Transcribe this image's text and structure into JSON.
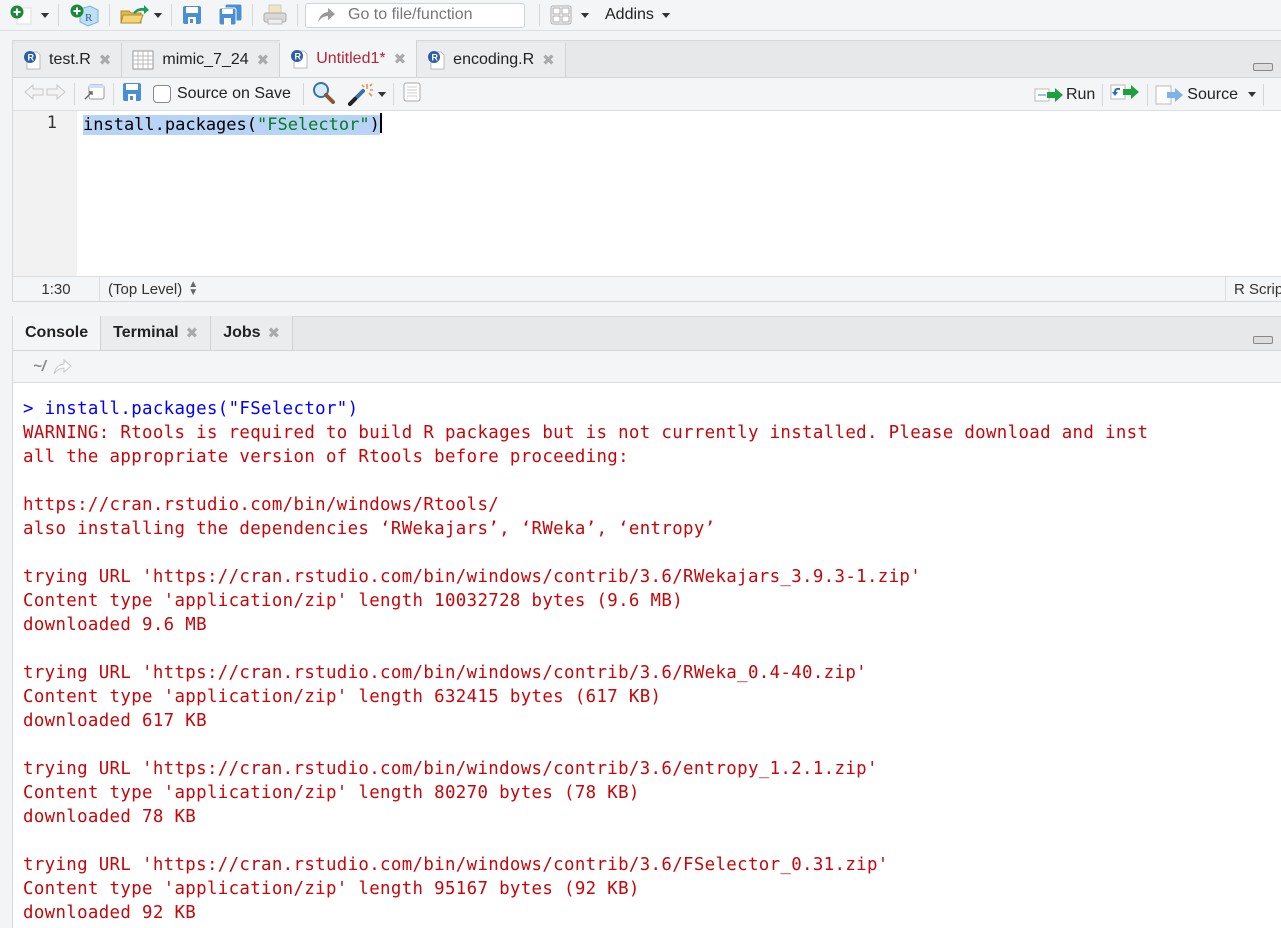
{
  "toolbar": {
    "goto_placeholder": "Go to file/function",
    "addins_label": "Addins",
    "icons": [
      "new-file-icon",
      "new-project-icon",
      "open-file-icon",
      "save-icon",
      "save-all-icon",
      "print-icon",
      "workspace-panes-icon"
    ]
  },
  "editor": {
    "tabs": [
      {
        "label": "test.R",
        "icon": "r-file-icon",
        "active": false
      },
      {
        "label": "mimic_7_24",
        "icon": "data-table-icon",
        "active": false
      },
      {
        "label": "Untitled1*",
        "icon": "r-file-icon",
        "active": true
      },
      {
        "label": "encoding.R",
        "icon": "r-file-icon",
        "active": false
      }
    ],
    "toolbar": {
      "source_on_save_label": "Source on Save",
      "source_on_save_checked": false,
      "run_label": "Run",
      "source_label": "Source"
    },
    "lines": [
      {
        "number": "1",
        "fn": "install.packages(",
        "str": "\"FSelector\"",
        "end": ")"
      }
    ],
    "status": {
      "position": "1:30",
      "scope": "(Top Level)",
      "file_type": "R Script"
    }
  },
  "console": {
    "tabs": [
      {
        "label": "Console",
        "active": true,
        "closable": false
      },
      {
        "label": "Terminal",
        "active": false,
        "closable": true
      },
      {
        "label": "Jobs",
        "active": false,
        "closable": true
      }
    ],
    "path": "~/",
    "colors": {
      "input": "#0000ff",
      "error": "#c5060b"
    },
    "lines": [
      {
        "type": "input",
        "text": "> install.packages(\"FSelector\")"
      },
      {
        "type": "err",
        "text": "WARNING: Rtools is required to build R packages but is not currently installed. Please download and inst"
      },
      {
        "type": "err",
        "text": "all the appropriate version of Rtools before proceeding:"
      },
      {
        "type": "blank",
        "text": ""
      },
      {
        "type": "err",
        "text": "https://cran.rstudio.com/bin/windows/Rtools/"
      },
      {
        "type": "err",
        "text": "also installing the dependencies ‘RWekajars’, ‘RWeka’, ‘entropy’"
      },
      {
        "type": "blank",
        "text": ""
      },
      {
        "type": "err",
        "text": "trying URL 'https://cran.rstudio.com/bin/windows/contrib/3.6/RWekajars_3.9.3-1.zip'"
      },
      {
        "type": "err",
        "text": "Content type 'application/zip' length 10032728 bytes (9.6 MB)"
      },
      {
        "type": "err",
        "text": "downloaded 9.6 MB"
      },
      {
        "type": "blank",
        "text": ""
      },
      {
        "type": "err",
        "text": "trying URL 'https://cran.rstudio.com/bin/windows/contrib/3.6/RWeka_0.4-40.zip'"
      },
      {
        "type": "err",
        "text": "Content type 'application/zip' length 632415 bytes (617 KB)"
      },
      {
        "type": "err",
        "text": "downloaded 617 KB"
      },
      {
        "type": "blank",
        "text": ""
      },
      {
        "type": "err",
        "text": "trying URL 'https://cran.rstudio.com/bin/windows/contrib/3.6/entropy_1.2.1.zip'"
      },
      {
        "type": "err",
        "text": "Content type 'application/zip' length 80270 bytes (78 KB)"
      },
      {
        "type": "err",
        "text": "downloaded 78 KB"
      },
      {
        "type": "blank",
        "text": ""
      },
      {
        "type": "err",
        "text": "trying URL 'https://cran.rstudio.com/bin/windows/contrib/3.6/FSelector_0.31.zip'"
      },
      {
        "type": "err",
        "text": "Content type 'application/zip' length 95167 bytes (92 KB)"
      },
      {
        "type": "err",
        "text": "downloaded 92 KB"
      }
    ]
  }
}
